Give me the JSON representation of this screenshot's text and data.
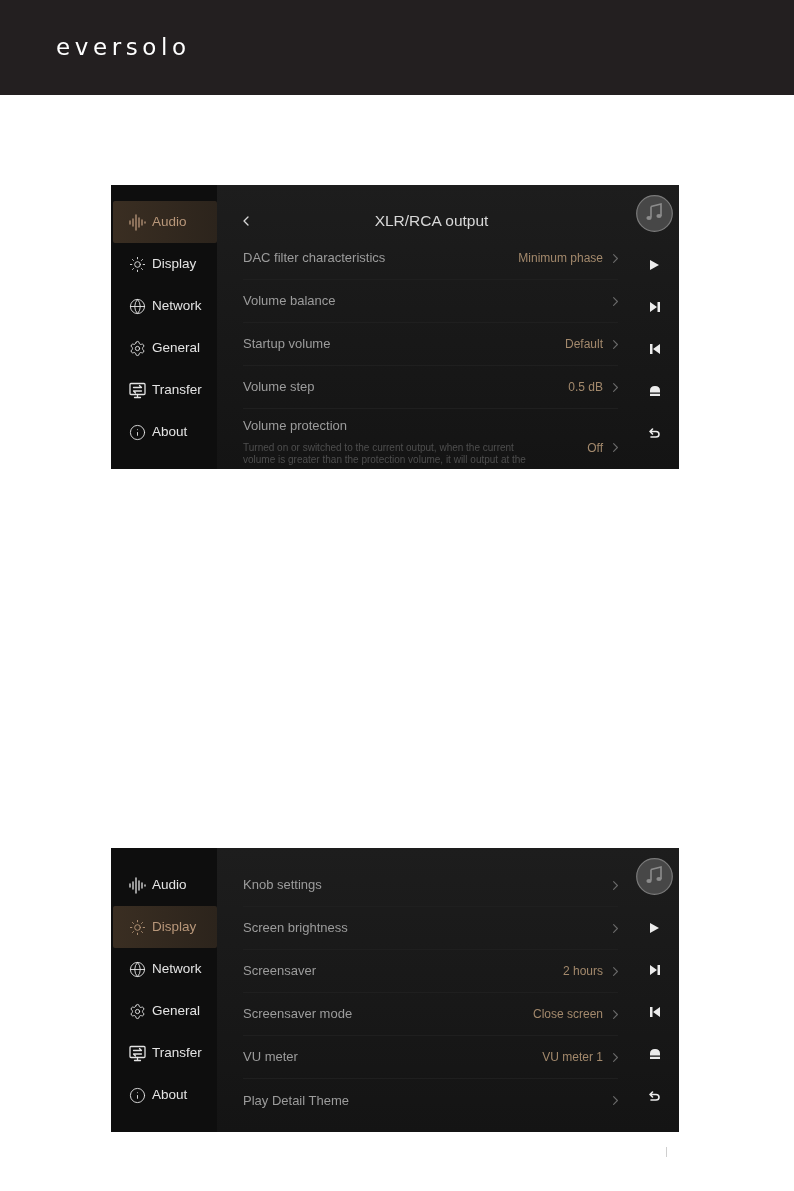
{
  "header": {
    "logo": "eversolo"
  },
  "screens": [
    {
      "sidebar": [
        {
          "kind": "audio",
          "label": "Audio",
          "selected": true
        },
        {
          "kind": "display",
          "label": "Display",
          "selected": false
        },
        {
          "kind": "network",
          "label": "Network",
          "selected": false
        },
        {
          "kind": "general",
          "label": "General",
          "selected": false
        },
        {
          "kind": "transfer",
          "label": "Transfer",
          "selected": false
        },
        {
          "kind": "about",
          "label": "About",
          "selected": false
        }
      ],
      "title": "XLR/RCA output",
      "rows": [
        {
          "label": "DAC filter characteristics",
          "value": "Minimum phase"
        },
        {
          "label": "Volume balance"
        },
        {
          "label": "Startup volume",
          "value": "Default"
        },
        {
          "label": "Volume step",
          "value": "0.5 dB"
        },
        {
          "label": "Volume protection",
          "description": "Turned on or switched to the current output, when the current volume is greater than the protection volume, it will output at the",
          "value": "Off"
        }
      ]
    },
    {
      "sidebar": [
        {
          "kind": "audio",
          "label": "Audio",
          "selected": false
        },
        {
          "kind": "display",
          "label": "Display",
          "selected": true
        },
        {
          "kind": "network",
          "label": "Network",
          "selected": false
        },
        {
          "kind": "general",
          "label": "General",
          "selected": false
        },
        {
          "kind": "transfer",
          "label": "Transfer",
          "selected": false
        },
        {
          "kind": "about",
          "label": "About",
          "selected": false
        }
      ],
      "rows": [
        {
          "label": "Knob settings"
        },
        {
          "label": "Screen brightness"
        },
        {
          "label": "Screensaver",
          "value": "2 hours"
        },
        {
          "label": "Screensaver mode",
          "value": "Close screen"
        },
        {
          "label": "VU meter",
          "value": "VU meter 1"
        },
        {
          "label": "Play Detail Theme"
        }
      ]
    }
  ]
}
